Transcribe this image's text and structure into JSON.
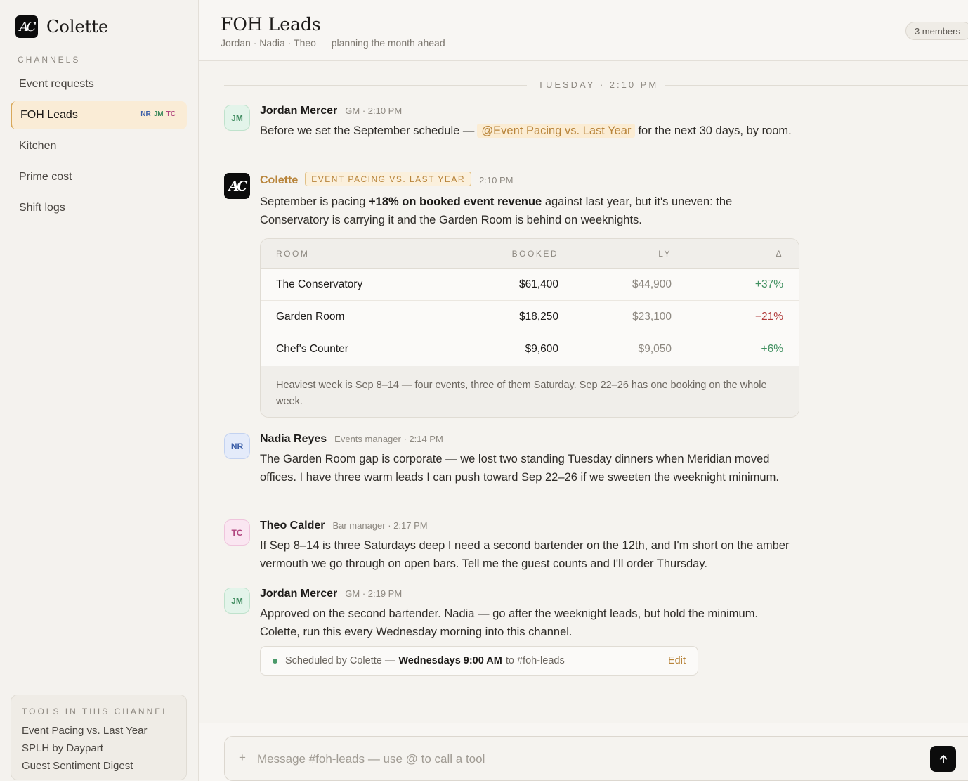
{
  "app": {
    "brand": "Colette",
    "logo_text": "AC"
  },
  "sidebar": {
    "section_label": "CHANNELS",
    "channels": [
      {
        "label": "Event requests"
      },
      {
        "label": "FOH Leads",
        "active": true,
        "avatars": [
          "NR",
          "JM",
          "TC"
        ]
      },
      {
        "label": "Kitchen"
      },
      {
        "label": "Prime cost"
      },
      {
        "label": "Shift logs"
      }
    ],
    "tools_title": "TOOLS IN THIS CHANNEL",
    "tools": [
      "Event Pacing vs. Last Year",
      "SPLH by Daypart",
      "Guest Sentiment Digest"
    ]
  },
  "header": {
    "title": "FOH Leads",
    "subtitle": "Jordan · Nadia · Theo — planning the month ahead",
    "members": "3 members"
  },
  "feed": {
    "day_divider": "TUESDAY · 2:10 PM",
    "messages": [
      {
        "initials": "JM",
        "name": "Jordan Mercer",
        "meta": "GM · 2:10 PM",
        "text_before": "Before we set the September schedule —",
        "mention": "@Event Pacing vs. Last Year",
        "text_after": "for the next 30 days, by room."
      },
      {
        "initials": "AC",
        "name": "Colette",
        "badge": "EVENT PACING VS. LAST YEAR",
        "meta": "2:10 PM",
        "text_before": "September is pacing",
        "bold": "+18% on booked event revenue",
        "text_after": "against last year, but it's uneven: the Conservatory is carrying it and the Garden Room is behind on weeknights.",
        "table": {
          "headers": {
            "room": "ROOM",
            "booked": "BOOKED",
            "ly": "LY",
            "delta": "Δ"
          },
          "rows": [
            {
              "room": "The Conservatory",
              "booked": "$61,400",
              "ly": "$44,900",
              "delta": "+37%",
              "trend": "up"
            },
            {
              "room": "Garden Room",
              "booked": "$18,250",
              "ly": "$23,100",
              "delta": "−21%",
              "trend": "down"
            },
            {
              "room": "Chef's Counter",
              "booked": "$9,600",
              "ly": "$9,050",
              "delta": "+6%",
              "trend": "up"
            }
          ],
          "footnote": "Heaviest week is Sep 8–14 — four events, three of them Saturday. Sep 22–26 has one booking on the whole week."
        }
      },
      {
        "initials": "NR",
        "name": "Nadia Reyes",
        "meta": "Events manager · 2:14 PM",
        "text": "The Garden Room gap is corporate — we lost two standing Tuesday dinners when Meridian moved offices. I have three warm leads I can push toward Sep 22–26 if we sweeten the weeknight minimum."
      },
      {
        "initials": "TC",
        "name": "Theo Calder",
        "meta": "Bar manager · 2:17 PM",
        "text": "If Sep 8–14 is three Saturdays deep I need a second bartender on the 12th, and I'm short on the amber vermouth we go through on open bars. Tell me the guest counts and I'll order Thursday."
      },
      {
        "initials": "JM",
        "name": "Jordan Mercer",
        "meta": "GM · 2:19 PM",
        "text": "Approved on the second bartender. Nadia — go after the weeknight leads, but hold the minimum. Colette, run this every Wednesday morning into this channel.",
        "schedule": {
          "prefix": "Scheduled by Colette —",
          "when": "Wednesdays 9:00 AM",
          "suffix": "to #foh-leads",
          "edit": "Edit"
        }
      }
    ]
  },
  "composer": {
    "plus": "+",
    "placeholder": "Message #foh-leads — use @ to call a tool",
    "value": ""
  },
  "colors": {
    "accent": "#b8843a",
    "positive": "#3f8f5f",
    "negative": "#b03a3a",
    "active_channel_bg": "#faecd6"
  },
  "icons": {
    "send": "arrow-up-icon",
    "status": "green-dot-icon",
    "attach": "plus-icon"
  }
}
